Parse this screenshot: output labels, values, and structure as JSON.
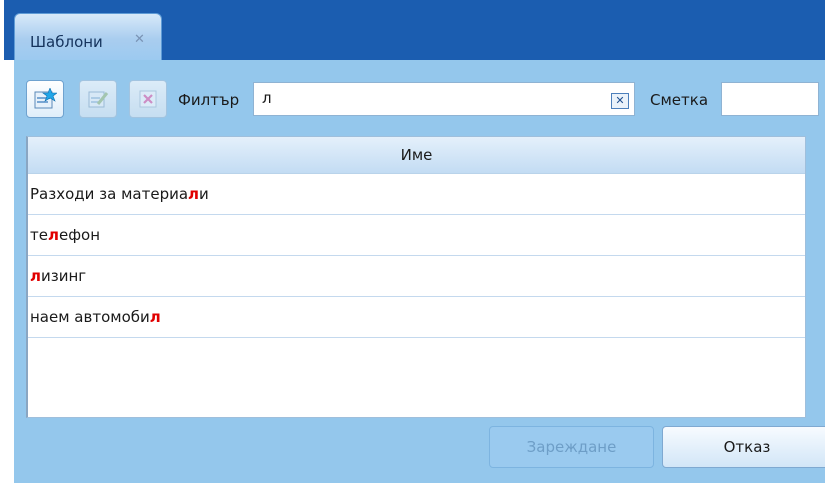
{
  "tab": {
    "title": "Шаблони",
    "close_glyph": "✕"
  },
  "toolbar": {
    "new_icon": "new-template-icon",
    "edit_icon": "edit-icon",
    "delete_icon": "delete-icon",
    "filter_label": "Филтър",
    "filter_value": "л",
    "clear_glyph": "✕",
    "account_label": "Сметка",
    "account_value": ""
  },
  "grid": {
    "column_header": "Име",
    "rows": [
      {
        "before": "Разходи за материа",
        "match": "л",
        "after": "и"
      },
      {
        "before": "те",
        "match": "л",
        "after": "ефон"
      },
      {
        "before": "",
        "match": "л",
        "after": "изинг"
      },
      {
        "before": "наем автомоби",
        "match": "л",
        "after": ""
      }
    ]
  },
  "buttons": {
    "load": "Зареждане",
    "cancel": "Отказ"
  },
  "colors": {
    "title_bar": "#1b5db0",
    "panel": "#94c7ec",
    "highlight": "#e10000"
  }
}
